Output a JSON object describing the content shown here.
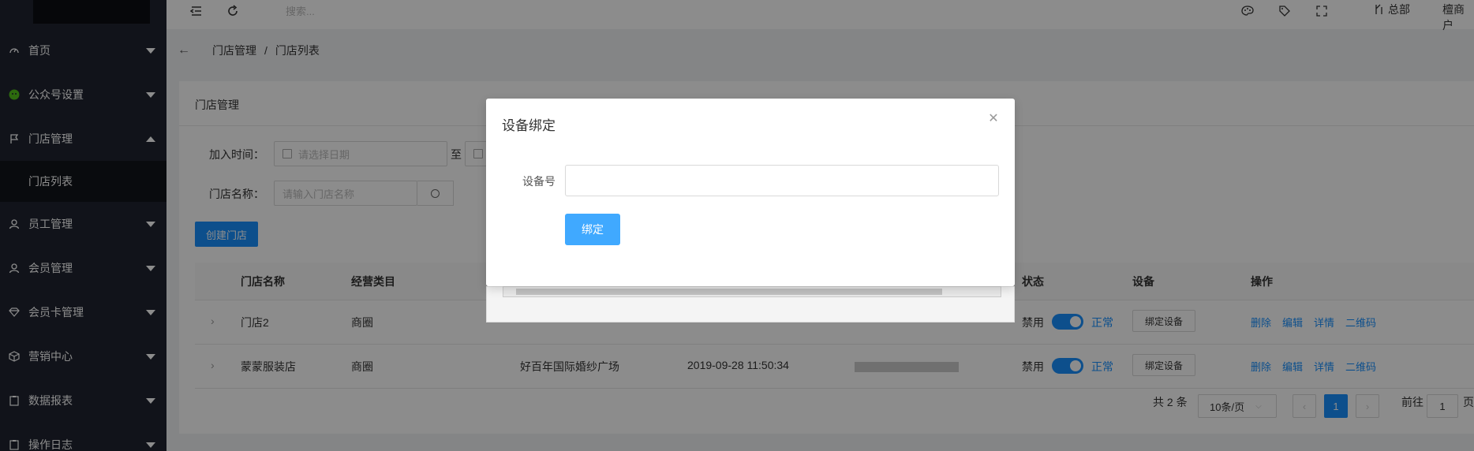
{
  "sidebar": {
    "items": [
      {
        "label": "首页",
        "icon": "gauge-icon"
      },
      {
        "label": "公众号设置",
        "icon": "wechat-icon"
      },
      {
        "label": "门店管理",
        "icon": "flag-icon",
        "expanded": true
      },
      {
        "label": "员工管理",
        "icon": "user-icon"
      },
      {
        "label": "会员管理",
        "icon": "user-icon"
      },
      {
        "label": "会员卡管理",
        "icon": "diamond-icon"
      },
      {
        "label": "营销中心",
        "icon": "cube-icon"
      },
      {
        "label": "数据报表",
        "icon": "clipboard-icon"
      },
      {
        "label": "操作日志",
        "icon": "clipboard-icon"
      }
    ],
    "sub_items": [
      {
        "label": "门店列表"
      }
    ]
  },
  "header": {
    "search_placeholder": "搜索...",
    "branch": "总部",
    "user": "檀商户"
  },
  "breadcrumb": {
    "items": [
      "门店管理",
      "门店列表"
    ],
    "separator": "/"
  },
  "card": {
    "title": "门店管理",
    "filters": {
      "join_time_label": "加入时间：",
      "date_placeholder": "请选择日期",
      "to_label": "至",
      "store_name_label": "门店名称：",
      "store_name_placeholder": "请输入门店名称"
    },
    "create_button": "创建门店",
    "columns": [
      "门店名称",
      "经营类目",
      "状态",
      "设备",
      "操作"
    ],
    "rows": [
      {
        "name": "门店2",
        "category": "商圈",
        "address": "",
        "time": "",
        "status_off": "禁用",
        "status_on": "正常",
        "device_btn": "绑定设备",
        "actions": [
          "删除",
          "编辑",
          "详情",
          "二维码"
        ]
      },
      {
        "name": "蒙蒙服装店",
        "category": "商圈",
        "address": "好百年国际婚纱广场",
        "time": "2019-09-28 11:50:34",
        "status_off": "禁用",
        "status_on": "正常",
        "device_btn": "绑定设备",
        "actions": [
          "删除",
          "编辑",
          "详情",
          "二维码"
        ]
      }
    ],
    "pagination": {
      "total": "共 2 条",
      "page_size": "10条/页",
      "current_page": "1",
      "goto_label": "前往",
      "goto_value": "1",
      "page_suffix": "页"
    }
  },
  "modal": {
    "title": "设备绑定",
    "device_label": "设备号",
    "device_value": "",
    "bind_button": "绑定"
  },
  "colors": {
    "primary": "#1890ff",
    "sidebar": "#1f2430",
    "bind_button": "#40a9ff"
  }
}
